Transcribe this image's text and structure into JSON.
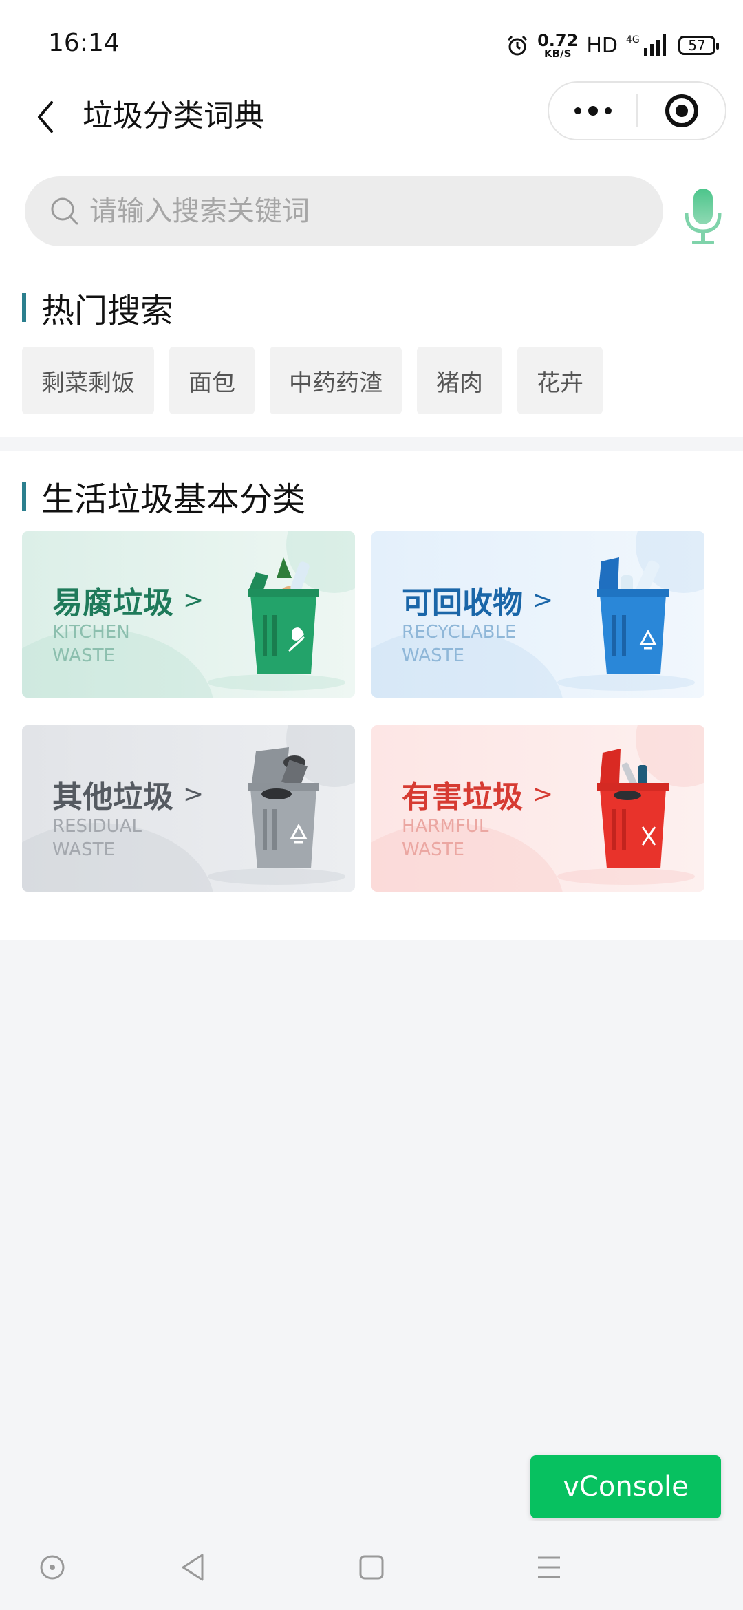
{
  "status_bar": {
    "time": "16:14",
    "net_speed_value": "0.72",
    "net_speed_unit": "KB/S",
    "hd": "HD",
    "network": "4G",
    "battery": "57",
    "icons": [
      "alarm-icon",
      "signal-icon",
      "battery-icon"
    ]
  },
  "nav": {
    "title": "垃圾分类词典",
    "back_icon": "chevron-left-icon",
    "menu_icon": "more-dots-icon",
    "close_icon": "target-circle-icon"
  },
  "search": {
    "placeholder": "请输入搜索关键词",
    "value": "",
    "mic_icon": "microphone-icon"
  },
  "hot": {
    "title": "热门搜索",
    "tags": [
      "剩菜剩饭",
      "面包",
      "中药药渣",
      "猪肉",
      "花卉"
    ]
  },
  "categories": {
    "title": "生活垃圾基本分类",
    "items": [
      {
        "cn": "易腐垃圾",
        "en1": "KITCHEN",
        "en2": "WASTE",
        "chevron": ">",
        "color": "#1e7a5a"
      },
      {
        "cn": "可回收物",
        "en1": "RECYCLABLE",
        "en2": "WASTE",
        "chevron": ">",
        "color": "#1a66a8"
      },
      {
        "cn": "其他垃圾",
        "en1": "RESIDUAL",
        "en2": "WASTE",
        "chevron": ">",
        "color": "#555a61"
      },
      {
        "cn": "有害垃圾",
        "en1": "HARMFUL",
        "en2": "WASTE",
        "chevron": ">",
        "color": "#d63b32"
      }
    ]
  },
  "vconsole": {
    "label": "vConsole",
    "color": "#07c160"
  },
  "accent": "#2b7f8e"
}
